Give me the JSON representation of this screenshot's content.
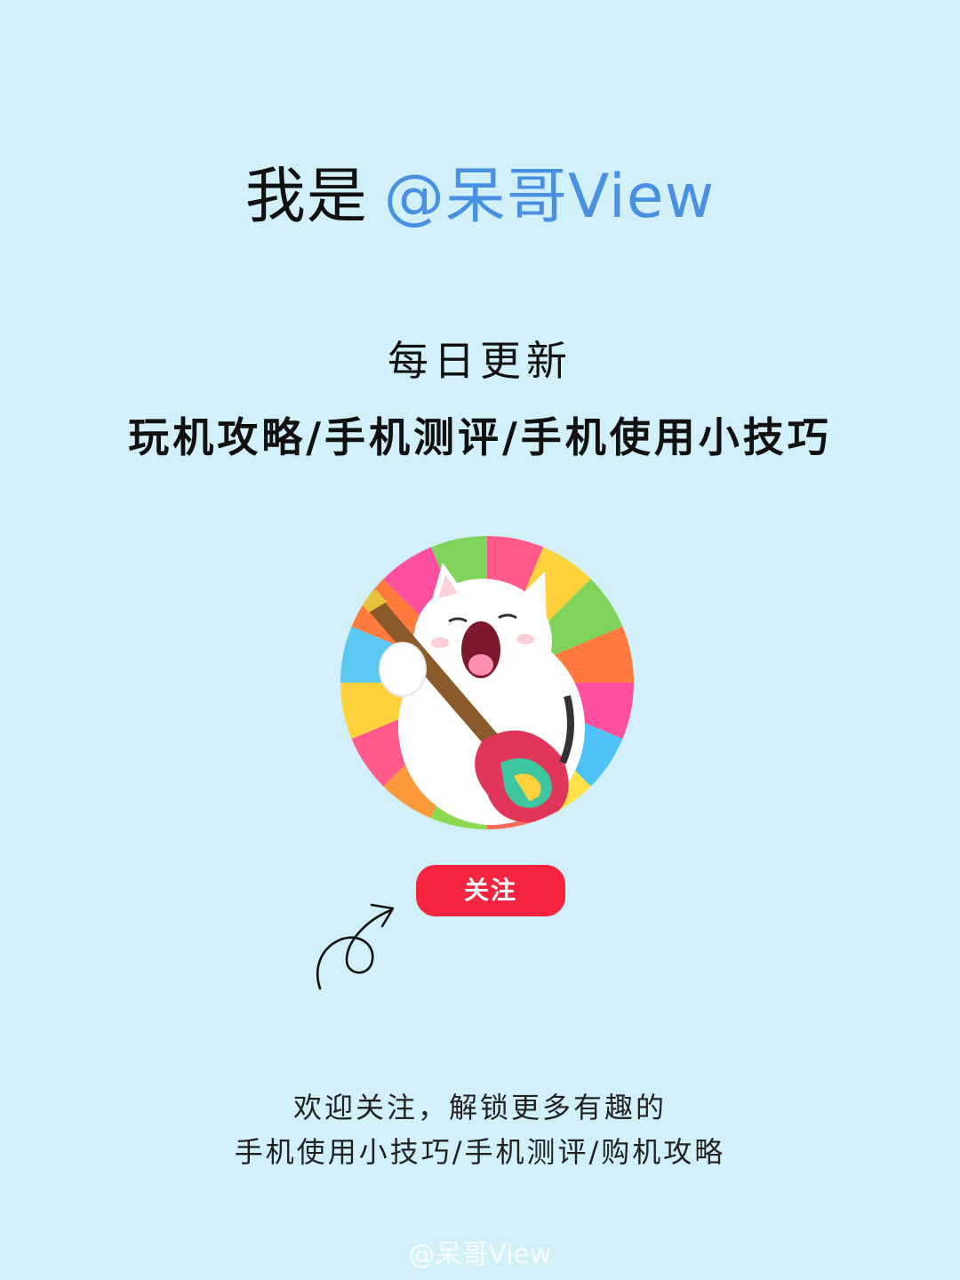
{
  "header": {
    "intro": "我是",
    "handle": "@呆哥View"
  },
  "tagline": {
    "daily": "每日更新",
    "topics": "玩机攻略/手机测评/手机使用小技巧"
  },
  "avatar": {
    "description": "rainbow-cat-guitar-avatar"
  },
  "follow_button": {
    "label": "关注",
    "color": "#f7243f"
  },
  "invite": {
    "line1": "欢迎关注，解锁更多有趣的",
    "line2": "手机使用小技巧/手机测评/购机攻略"
  },
  "watermark": {
    "text": "@呆哥View"
  },
  "colors": {
    "background": "#d2f0fa",
    "handle": "#4a90e2",
    "button": "#f7243f"
  }
}
